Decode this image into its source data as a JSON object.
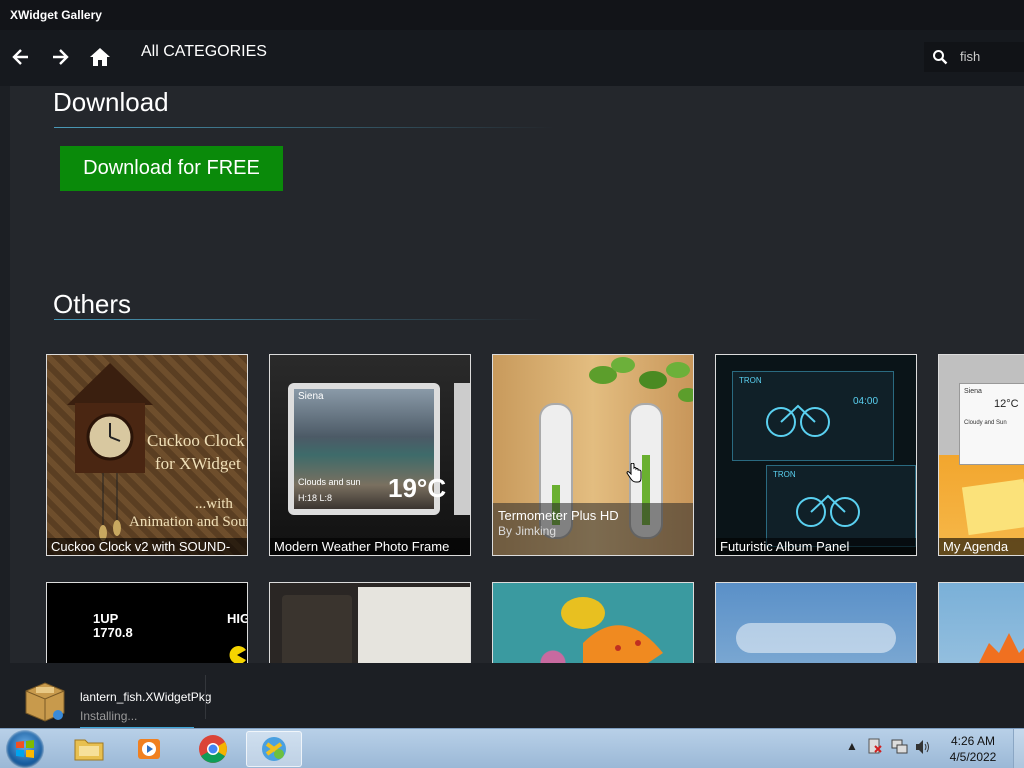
{
  "window": {
    "title": "XWidget Gallery"
  },
  "nav": {
    "back_icon": "arrow-left-icon",
    "forward_icon": "arrow-right-icon",
    "home_icon": "home-icon",
    "title": "All CATEGORIES",
    "search": {
      "value": "fish",
      "icon": "search-icon"
    }
  },
  "download_section": {
    "title": "Download",
    "button_label": "Download for FREE",
    "button_color": "#0a8a0a"
  },
  "others_section": {
    "title": "Others",
    "cards": [
      {
        "caption": "Cuckoo Clock v2 with SOUND-",
        "overlay_text_1": "Cuckoo Clock",
        "overlay_text_2": "for XWidget",
        "overlay_text_3": "...with",
        "overlay_text_4": "Animation and Sound"
      },
      {
        "caption": "Modern Weather Photo Frame",
        "city": "Siena",
        "conditions": "Clouds and sun",
        "hilo": "H:18  L:8",
        "temp": "19°C"
      },
      {
        "hover_title": "Termometer Plus HD",
        "hover_author": "By Jimking"
      },
      {
        "caption": "Futuristic Album Panel",
        "time": "04:00",
        "brand": "TRON"
      },
      {
        "caption": "My Agenda",
        "temp": "12°C",
        "city": "Siena",
        "conditions": "Cloudy and Sun"
      }
    ],
    "row2_cards": [
      {
        "score_1": "1UP",
        "score_2": "1770.8",
        "score_3": "HIG"
      },
      {},
      {},
      {},
      {}
    ]
  },
  "download_panel": {
    "filename": "lantern_fish.XWidgetPkg",
    "status": "Installing...",
    "progress": 1.0
  },
  "taskbar": {
    "apps": [
      "windows-explorer",
      "media-player",
      "chrome",
      "xwidget"
    ],
    "clock": {
      "time": "4:26 AM",
      "date": "4/5/2022"
    }
  }
}
